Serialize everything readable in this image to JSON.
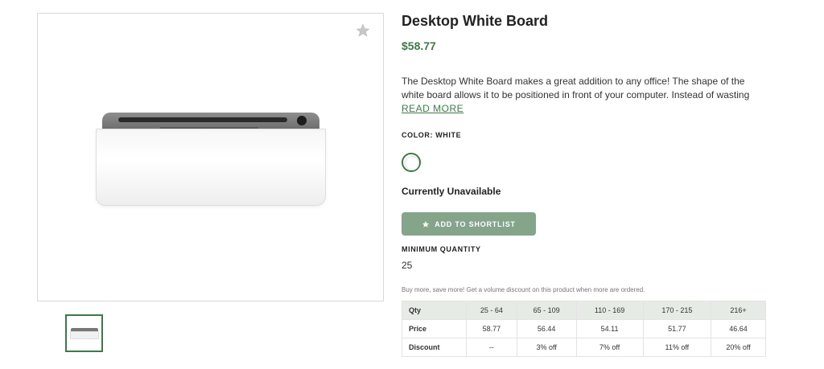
{
  "product": {
    "title": "Desktop White Board",
    "price": "$58.77",
    "description": "The Desktop White Board makes a great addition to any office! The shape of the white board allows it to be positioned in front of your computer. Instead of wasting sticky…",
    "read_more": "READ MORE",
    "color_label": "COLOR: WHITE",
    "availability": "Currently Unavailable",
    "shortlist_button": "ADD TO SHORTLIST",
    "min_qty_label": "MINIMUM QUANTITY",
    "min_qty_value": "25",
    "volume_note": "Buy more, save more! Get a volume discount on this product when more are ordered."
  },
  "pricing_table": {
    "header": [
      "Qty",
      "25 - 64",
      "65 - 109",
      "110 - 169",
      "170 - 215",
      "216+"
    ],
    "price": [
      "Price",
      "58.77",
      "56.44",
      "54.11",
      "51.77",
      "46.64"
    ],
    "discount": [
      "Discount",
      "--",
      "3% off",
      "7% off",
      "11% off",
      "20% off"
    ]
  },
  "colors": {
    "accent": "#3e7a48",
    "button": "#84a58a",
    "table_header": "#e6ebe6"
  },
  "icons": {
    "favorite": "star-icon",
    "shortlist": "star-icon"
  }
}
